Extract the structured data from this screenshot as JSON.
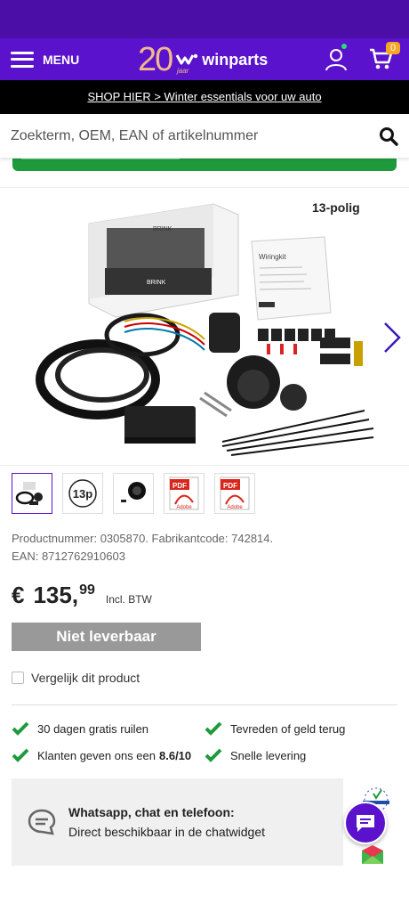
{
  "header": {
    "menu_label": "MENU",
    "logo_number": "20",
    "logo_jaar": "jaar",
    "logo_text": "winparts",
    "cart_count": "0",
    "brand_color": "#5a12cc"
  },
  "promo": {
    "text": "SHOP HIER > Winter essentials voor uw auto"
  },
  "search": {
    "placeholder": "Zoekterm, OEM, EAN of artikelnummer"
  },
  "gallery": {
    "badge": "13-polig",
    "thumbs": [
      {
        "type": "photo"
      },
      {
        "type": "13p",
        "label": "13p"
      },
      {
        "type": "socket"
      },
      {
        "type": "pdf",
        "label": "Adobe"
      },
      {
        "type": "pdf",
        "label": "Adobe"
      }
    ]
  },
  "product": {
    "codes_line1": "Productnummer: 0305870. Fabrikantcode: 742814.",
    "codes_line2": "EAN: 8712762910603",
    "currency": "€",
    "price_whole": "135,",
    "price_cents": "99",
    "price_tax": "Incl. BTW",
    "unavailable_label": "Niet leverbaar",
    "compare_label": "Vergelijk dit product"
  },
  "usps": {
    "free_returns": "30 dagen gratis ruilen",
    "satisfaction": "Tevreden of geld terug",
    "rating_prefix": "Klanten geven ons een",
    "rating_value": "8.6/10",
    "fast_delivery": "Snelle levering"
  },
  "chat": {
    "title": "Whatsapp, chat en telefoon:",
    "subtitle": "Direct beschikbaar in de chatwidget"
  }
}
